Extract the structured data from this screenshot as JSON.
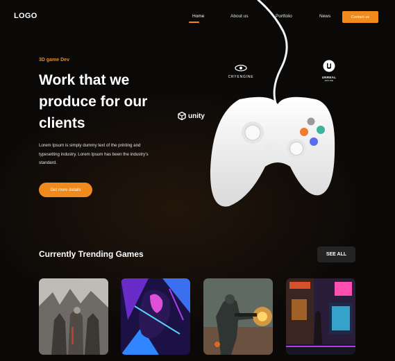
{
  "header": {
    "logo": "LOGO",
    "nav": [
      {
        "label": "Home",
        "active": true
      },
      {
        "label": "About us",
        "active": false
      },
      {
        "label": "Portfolio",
        "active": false
      },
      {
        "label": "News",
        "active": false
      }
    ],
    "contact_label": "Contact us"
  },
  "hero": {
    "kicker": "3D game Dev",
    "headline_lines": [
      "Work that we",
      "produce for our",
      "clients"
    ],
    "description_lines": [
      "Lorem Ipsum is simply dummy text of the printing and",
      "typesetting industry. Lorem Ipsum has been the industry's",
      "standard."
    ],
    "cta_label": "Get more details"
  },
  "engines": {
    "cryengine": "CRYENGINE",
    "unreal_top": "UNREAL",
    "unreal_bottom": "ENGINE",
    "unity": "unity"
  },
  "trending": {
    "title": "Currently Trending Games",
    "see_all_label": "SEE ALL",
    "games": [
      {
        "icon": "knights-artwork"
      },
      {
        "icon": "neon-warrior-artwork"
      },
      {
        "icon": "soldier-artwork"
      },
      {
        "icon": "cyberpunk-street-artwork"
      }
    ]
  },
  "colors": {
    "accent": "#f08a1c",
    "background": "#0a0908",
    "button_dark": "#242424"
  }
}
